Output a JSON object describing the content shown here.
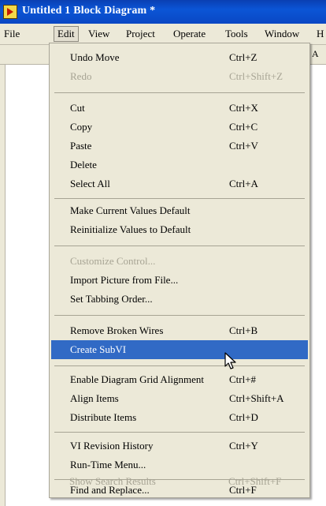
{
  "window": {
    "title": "Untitled 1 Block Diagram *"
  },
  "menubar": {
    "items": [
      "File",
      "Edit",
      "View",
      "Project",
      "Operate",
      "Tools",
      "Window",
      "H"
    ],
    "active": "Edit"
  },
  "toolbar": {
    "fragment": "A"
  },
  "edit_menu": {
    "items": [
      {
        "label": "Undo Move",
        "shortcut": "Ctrl+Z",
        "enabled": true
      },
      {
        "label": "Redo",
        "shortcut": "Ctrl+Shift+Z",
        "enabled": false
      },
      {
        "label": "Cut",
        "shortcut": "Ctrl+X",
        "enabled": true
      },
      {
        "label": "Copy",
        "shortcut": "Ctrl+C",
        "enabled": true
      },
      {
        "label": "Paste",
        "shortcut": "Ctrl+V",
        "enabled": true
      },
      {
        "label": "Delete",
        "shortcut": "",
        "enabled": true
      },
      {
        "label": "Select All",
        "shortcut": "Ctrl+A",
        "enabled": true
      },
      {
        "label": "Make Current Values Default",
        "shortcut": "",
        "enabled": true
      },
      {
        "label": "Reinitialize Values to Default",
        "shortcut": "",
        "enabled": true
      },
      {
        "label": "Customize Control...",
        "shortcut": "",
        "enabled": false
      },
      {
        "label": "Import Picture from File...",
        "shortcut": "",
        "enabled": true
      },
      {
        "label": "Set Tabbing Order...",
        "shortcut": "",
        "enabled": true
      },
      {
        "label": "Remove Broken Wires",
        "shortcut": "Ctrl+B",
        "enabled": true
      },
      {
        "label": "Create SubVI",
        "shortcut": "",
        "enabled": true,
        "highlighted": true
      },
      {
        "label": "Enable Diagram Grid Alignment",
        "shortcut": "Ctrl+#",
        "enabled": true
      },
      {
        "label": "Align Items",
        "shortcut": "Ctrl+Shift+A",
        "enabled": true
      },
      {
        "label": "Distribute Items",
        "shortcut": "Ctrl+D",
        "enabled": true
      },
      {
        "label": "VI Revision History",
        "shortcut": "Ctrl+Y",
        "enabled": true
      },
      {
        "label": "Run-Time Menu...",
        "shortcut": "",
        "enabled": true
      },
      {
        "label": "Find and Replace...",
        "shortcut": "Ctrl+F",
        "enabled": true
      },
      {
        "label": "Show Search Results",
        "shortcut": "Ctrl+Shift+F",
        "enabled": false
      }
    ]
  },
  "colors": {
    "title_bar": "#0b55d6",
    "menu_bg": "#ece9d8",
    "highlight": "#316ac5",
    "disabled_text": "#a7a494"
  }
}
